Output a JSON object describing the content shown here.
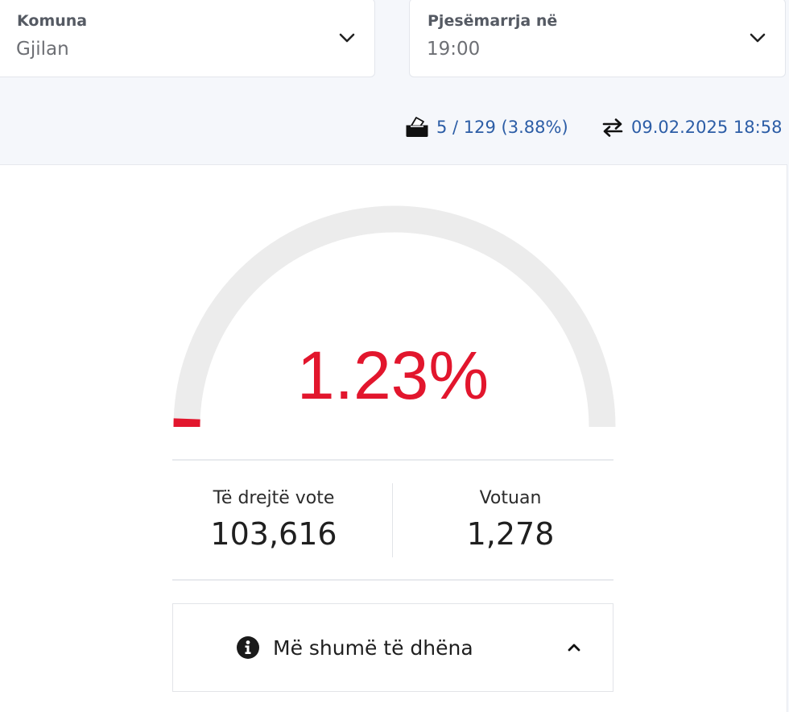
{
  "filters": {
    "municipality": {
      "label": "Komuna",
      "value": "Gjilan",
      "icon": "chevron-down-icon"
    },
    "turnout_time": {
      "label": "Pjesëmarrja në",
      "value": "19:00",
      "icon": "chevron-down-icon"
    }
  },
  "status": {
    "stations": {
      "text": "5 / 129 (3.88%)",
      "icon": "ballot-box-icon"
    },
    "updated": {
      "text": "09.02.2025 18:58",
      "icon": "exchange-arrows-icon"
    }
  },
  "turnout": {
    "percent_text": "1.23%",
    "fraction": 0.0123,
    "color_fill": "#e2162d",
    "color_track": "#ececec"
  },
  "stats": {
    "eligible": {
      "label": "Të drejtë vote",
      "value": "103,616"
    },
    "voted": {
      "label": "Votuan",
      "value": "1,278"
    }
  },
  "more_data": {
    "label": "Më shumë të dhëna",
    "icon": "info-circle-icon",
    "toggle_icon": "chevron-up-icon"
  },
  "colors": {
    "link": "#2c5da6",
    "accent": "#e2162d"
  }
}
